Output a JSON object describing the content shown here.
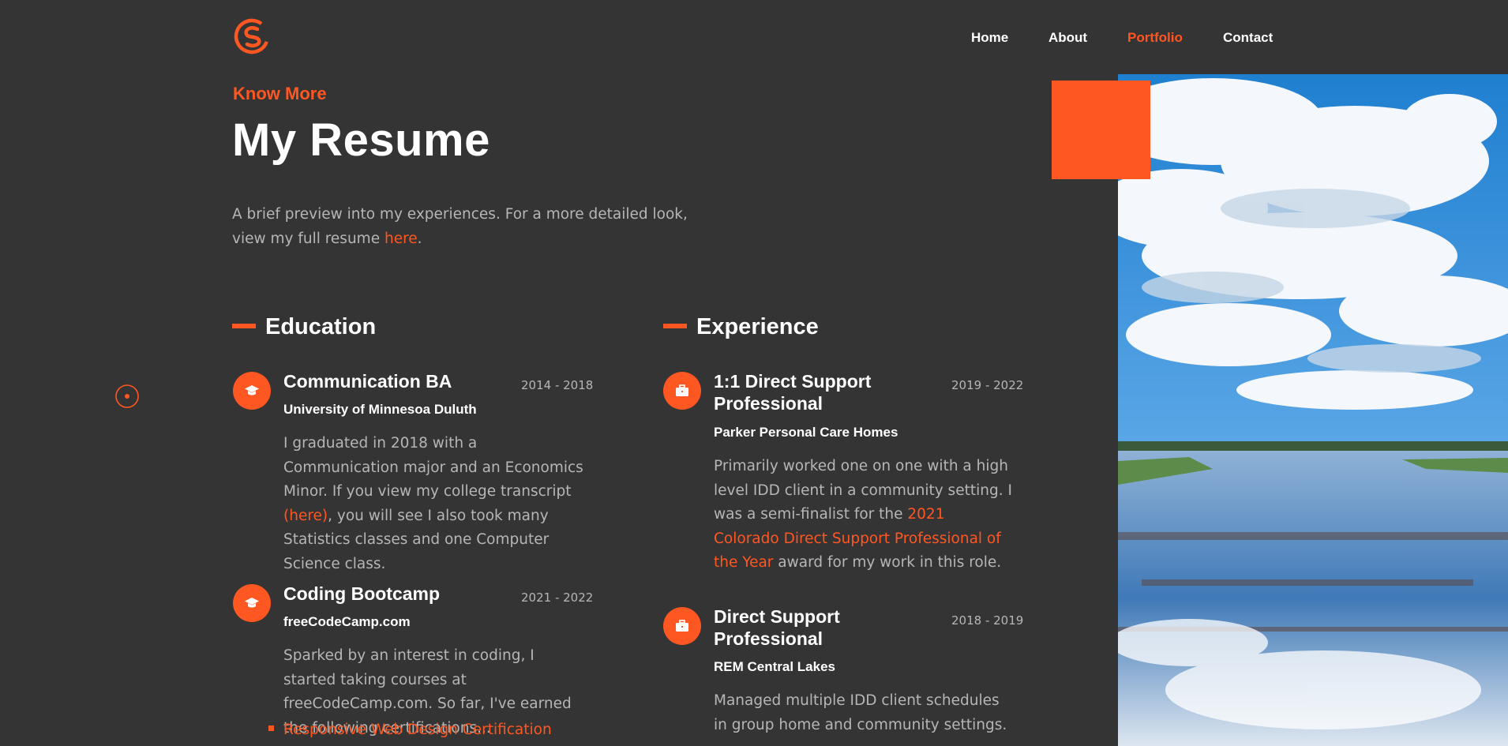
{
  "nav": {
    "home": "Home",
    "about": "About",
    "portfolio": "Portfolio",
    "contact": "Contact",
    "active": "Portfolio"
  },
  "icons": {
    "logo": "cs-logo-icon",
    "education": "graduation-cap-icon",
    "experience": "briefcase-icon",
    "scroll": "scroll-indicator-icon"
  },
  "colors": {
    "accent": "#ff5722",
    "background": "#343434",
    "muted_text": "#b6b6b6"
  },
  "hero": {
    "kicker": "Know More",
    "title": "My Resume",
    "intro_text": "A brief preview into my experiences. For a more detailed look, view my full resume ",
    "intro_link": "here",
    "intro_end": "."
  },
  "education": {
    "heading": "Education",
    "items": [
      {
        "title": "Communication BA",
        "org": "University of Minnesoa Duluth",
        "date": "2014 - 2018",
        "desc_1": "I graduated in 2018 with a Communication major and an Economics Minor. If you view my college transcript ",
        "desc_link": "(here)",
        "desc_2": ", you will see I also took many Statistics classes and one Computer Science class."
      },
      {
        "title": "Coding Bootcamp",
        "org": "freeCodeCamp.com",
        "date": "2021 - 2022",
        "desc": "Sparked by an interest in coding, I started taking courses at freeCodeCamp.com. So far, I've earned the following certifications...",
        "cert": "Responsive Web Design Certification"
      }
    ]
  },
  "experience": {
    "heading": "Experience",
    "items": [
      {
        "title": "1:1 Direct Support Professional",
        "org": "Parker Personal Care Homes",
        "date": "2019 - 2022",
        "desc_1": "Primarily worked one on one with a high level IDD client in a community setting. I was a semi-finalist for the ",
        "desc_link": "2021 Colorado Direct Support Professional of the Year",
        "desc_2": " award for my work in this role."
      },
      {
        "title": "Direct Support Professional",
        "org": "REM Central Lakes",
        "date": "2018 - 2019",
        "desc": "Managed multiple IDD client schedules in group home and community settings."
      }
    ]
  }
}
